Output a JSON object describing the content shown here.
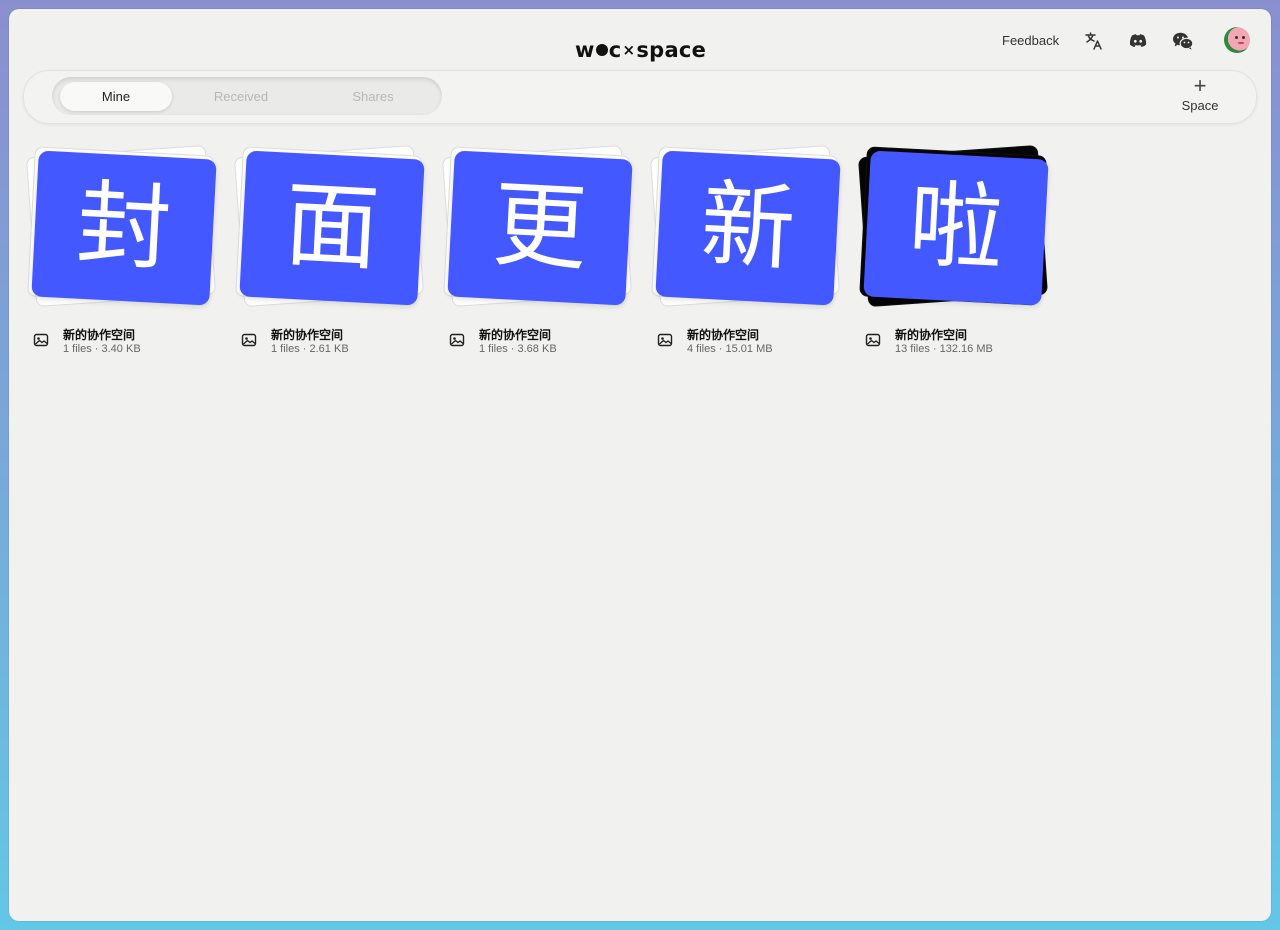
{
  "header": {
    "logo": {
      "w": "w",
      "c": "c",
      "x": "×",
      "space": "space"
    },
    "feedback_label": "Feedback",
    "icons": [
      "translate-icon",
      "discord-icon",
      "wechat-icon"
    ],
    "avatar": "avatar"
  },
  "tabs": [
    {
      "label": "Mine",
      "active": true
    },
    {
      "label": "Received",
      "active": false
    },
    {
      "label": "Shares",
      "active": false
    }
  ],
  "add_space": {
    "plus": "+",
    "label": "Space"
  },
  "colors": {
    "accent": "#4358ff",
    "background": "#f1f1ef"
  },
  "spaces": [
    {
      "cover_text": "封",
      "title": "新的协作空间",
      "files": "1 files · 3.40 KB"
    },
    {
      "cover_text": "面",
      "title": "新的协作空间",
      "files": "1 files · 2.61 KB"
    },
    {
      "cover_text": "更",
      "title": "新的协作空间",
      "files": "1 files · 3.68 KB"
    },
    {
      "cover_text": "新",
      "title": "新的协作空间",
      "files": "4 files · 15.01 MB"
    },
    {
      "cover_text": "啦",
      "title": "新的协作空间",
      "files": "13 files · 132.16 MB"
    }
  ]
}
